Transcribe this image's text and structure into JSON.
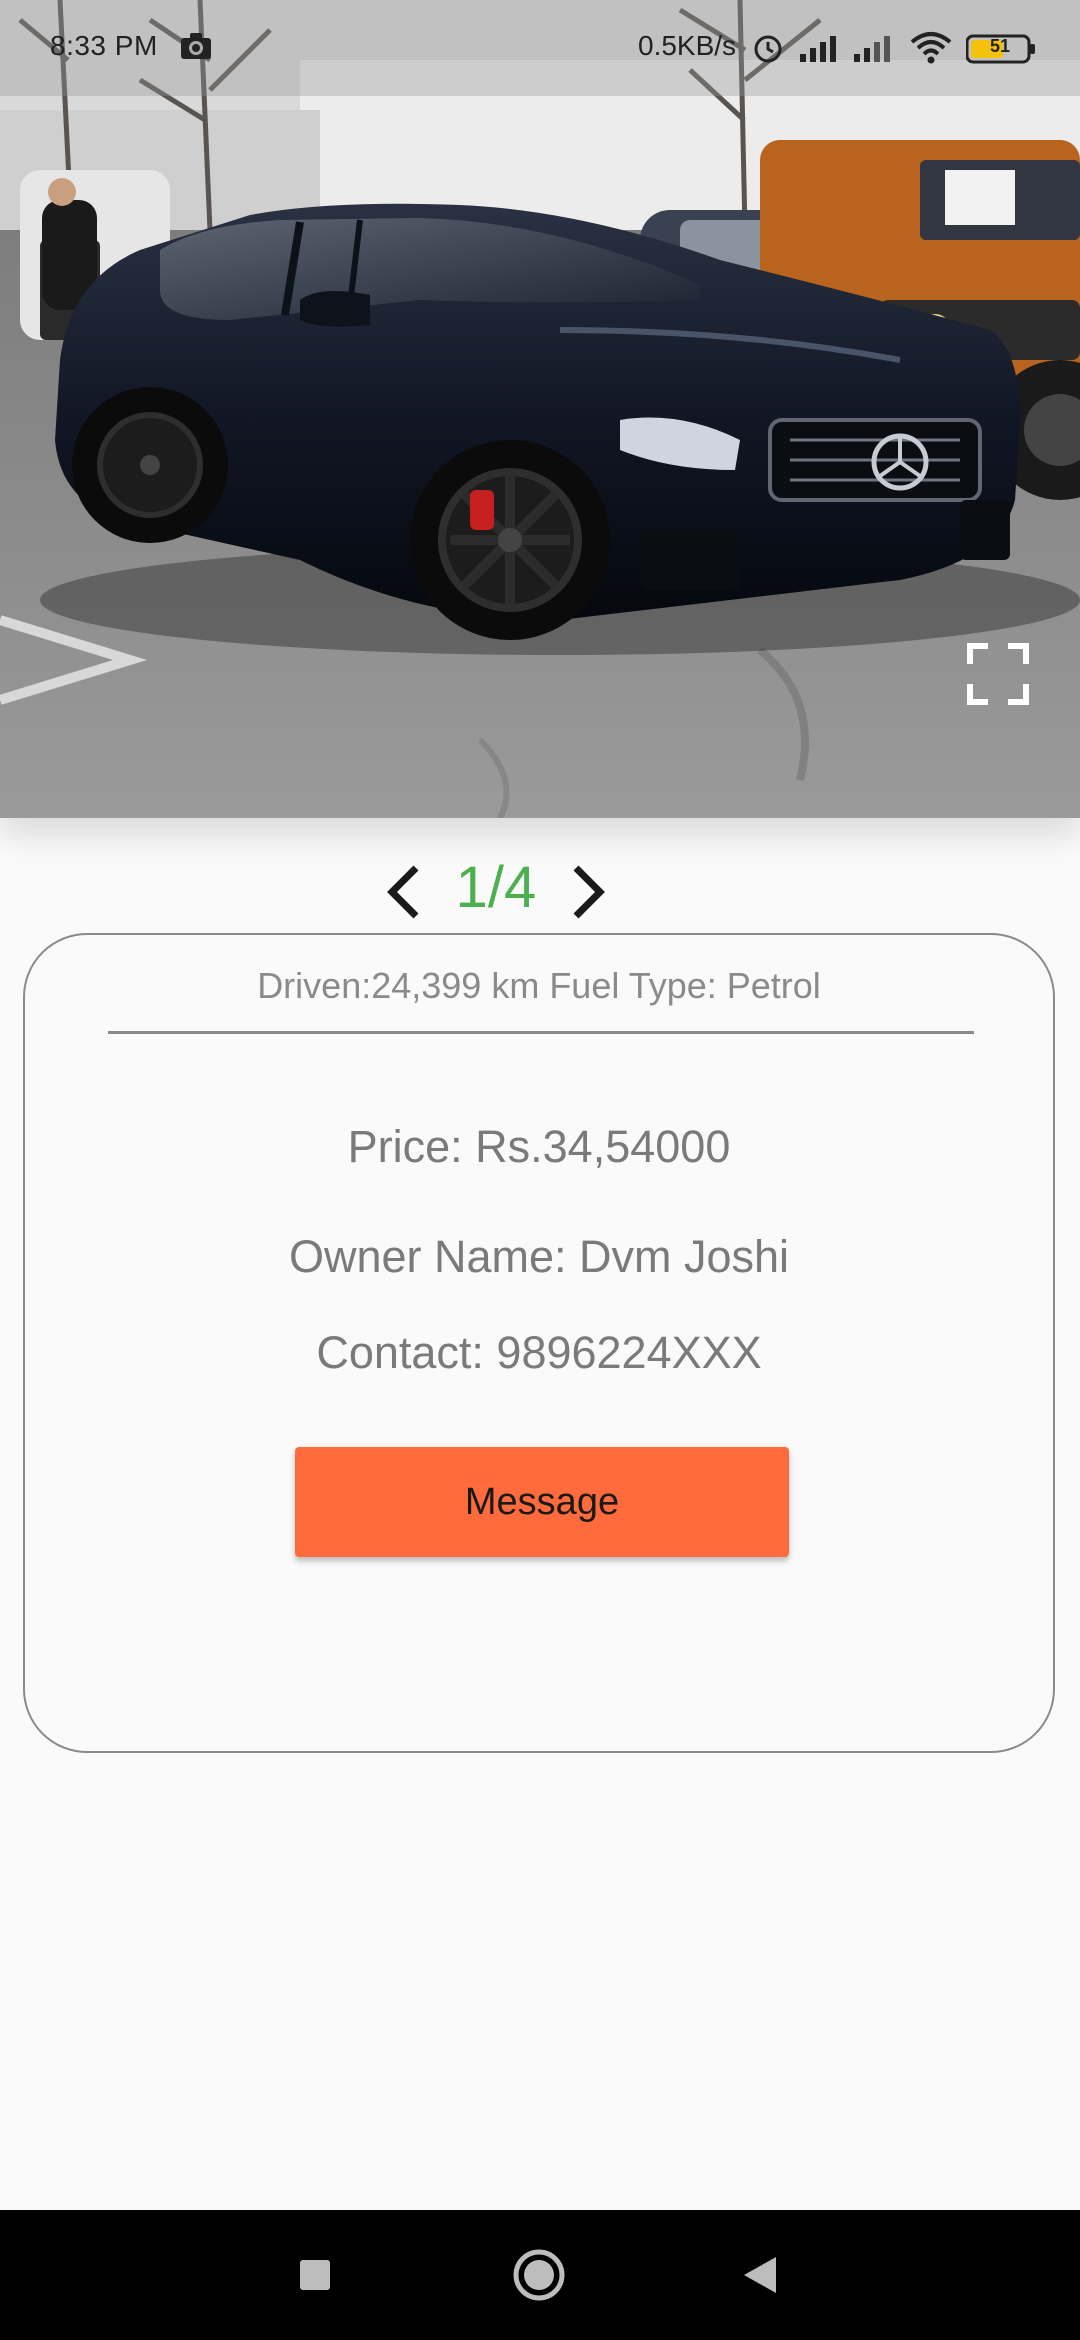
{
  "status_bar": {
    "time": "8:33 PM",
    "network_speed": "0.5KB/s",
    "battery_level": "51",
    "icons": [
      "camera-icon",
      "alarm-icon",
      "signal-icon",
      "signal-icon",
      "wifi-icon",
      "battery-icon"
    ]
  },
  "gallery": {
    "image_subject": "black sedan in parking lot",
    "current_page": 1,
    "total_pages": 4,
    "page_label": "1/4",
    "fullscreen_icon": "fullscreen-icon",
    "prev_icon": "chevron-left-icon",
    "next_icon": "chevron-right-icon"
  },
  "details": {
    "summary": "Driven:24,399 km Fuel Type: Petrol",
    "price": "Price: Rs.34,54000",
    "owner": "Owner Name: Dvm Joshi",
    "contact": "Contact: 9896224XXX"
  },
  "actions": {
    "message_label": "Message"
  },
  "colors": {
    "accent_button": "#ff6b3d",
    "pager_text": "#4caf50",
    "card_border": "#8a8a8a",
    "text_gray": "#7a7a7a"
  },
  "nav_bar": {
    "icons": [
      "recents-icon",
      "home-icon",
      "back-icon"
    ]
  }
}
